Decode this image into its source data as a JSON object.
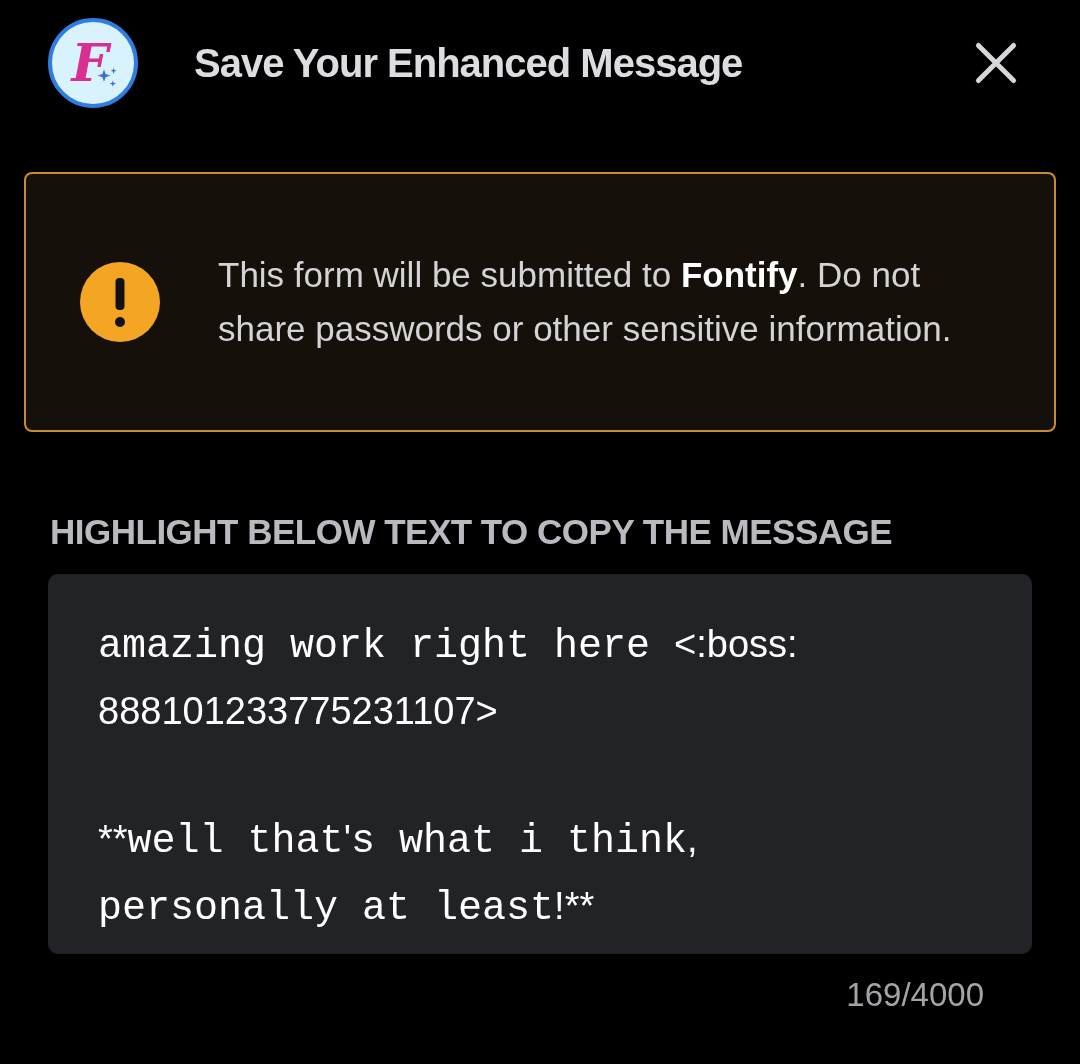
{
  "header": {
    "logo_letter": "F",
    "title": "Save Your Enhanced Message"
  },
  "notice": {
    "before": "This form will be submitted to ",
    "app": "Fontify",
    "after": ". Do not share passwords or other sensitive information."
  },
  "field": {
    "label": "HIGHLIGHT BELOW TEXT TO COPY THE MESSAGE",
    "paragraphs": [
      {
        "lines": [
          [
            {
              "kind": "mono",
              "text": "amazing work right here "
            },
            {
              "kind": "sans",
              "text": "<:boss:"
            }
          ],
          [
            {
              "kind": "sans",
              "text": "888101233775231107>"
            }
          ]
        ]
      },
      {
        "lines": [
          [
            {
              "kind": "sans",
              "text": "**"
            },
            {
              "kind": "mono",
              "text": "well that"
            },
            {
              "kind": "sans",
              "text": "'"
            },
            {
              "kind": "mono",
              "text": "s what i think"
            },
            {
              "kind": "sans",
              "text": ","
            }
          ],
          [
            {
              "kind": "mono",
              "text": "personally at least"
            },
            {
              "kind": "sans",
              "text": "!**"
            }
          ]
        ]
      }
    ],
    "counter": "169/4000"
  }
}
